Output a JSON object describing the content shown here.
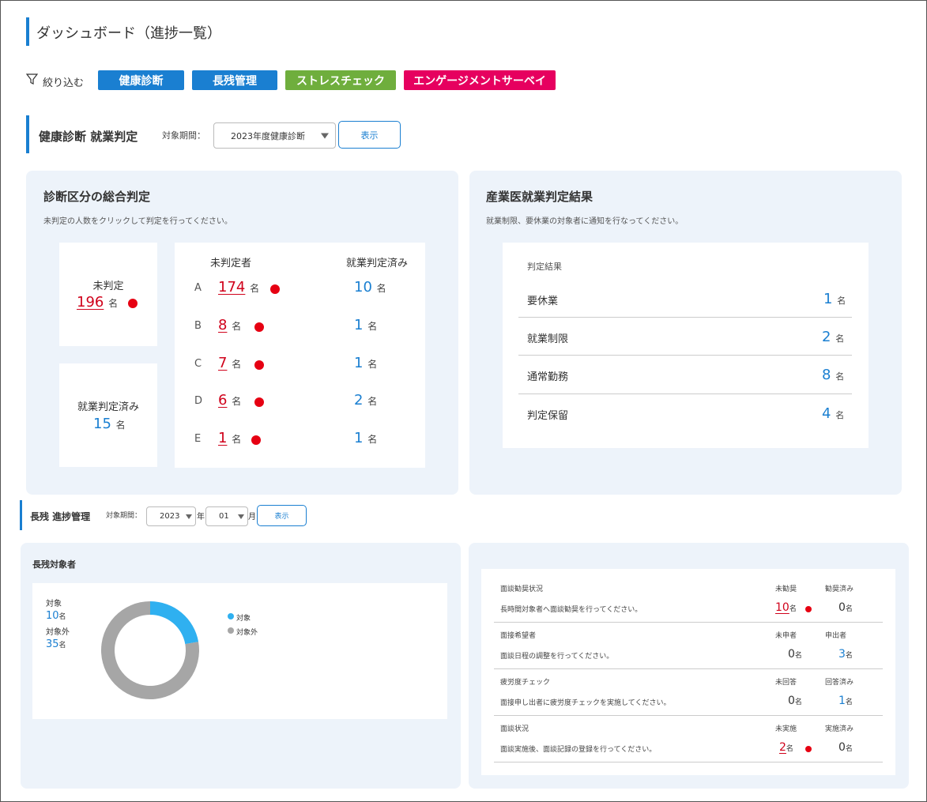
{
  "page_title": "ダッシュボード（進捗一覧）",
  "filter": {
    "label": "絞り込む",
    "chips": [
      {
        "label": "健康診断",
        "color": "#1a7fd1"
      },
      {
        "label": "長残管理",
        "color": "#1a7fd1"
      },
      {
        "label": "ストレスチェック",
        "color": "#6fae3d"
      },
      {
        "label": "エンゲージメントサーベイ",
        "color": "#e6005f"
      }
    ]
  },
  "health": {
    "title": "健康診断 就業判定",
    "period_label": "対象期間：",
    "period_value": "2023年度健康診断",
    "show_button": "表示",
    "overall": {
      "title": "診断区分の総合判定",
      "subtitle": "未判定の人数をクリックして判定を行ってください。",
      "undetermined_label": "未判定",
      "undetermined_value": "196",
      "decided_label": "就業判定済み",
      "decided_value": "15",
      "unit": "名",
      "col_undetermined": "未判定者",
      "col_decided": "就業判定済み",
      "rows": [
        {
          "grade": "A",
          "undetermined": "174",
          "decided": "10"
        },
        {
          "grade": "B",
          "undetermined": "8",
          "decided": "1"
        },
        {
          "grade": "C",
          "undetermined": "7",
          "decided": "1"
        },
        {
          "grade": "D",
          "undetermined": "6",
          "decided": "2"
        },
        {
          "grade": "E",
          "undetermined": "1",
          "decided": "1"
        }
      ]
    },
    "doctor": {
      "title": "産業医就業判定結果",
      "subtitle": "就業制限、要休業の対象者に通知を行なってください。",
      "header": "判定結果",
      "unit": "名",
      "rows": [
        {
          "label": "要休業",
          "value": "1"
        },
        {
          "label": "就業制限",
          "value": "2"
        },
        {
          "label": "通常勤務",
          "value": "8"
        },
        {
          "label": "判定保留",
          "value": "4"
        }
      ]
    }
  },
  "overtime": {
    "title": "長残 進捗管理",
    "period_label": "対象期間：",
    "year_value": "2023",
    "year_suffix": "年",
    "month_value": "01",
    "month_suffix": "月",
    "show_button": "表示",
    "targets": {
      "title": "長残対象者",
      "target_label": "対象",
      "target_value": "10",
      "nontarget_label": "対象外",
      "nontarget_value": "35",
      "unit": "名",
      "legend_target": "対象",
      "legend_nontarget": "対象外",
      "color_target": "#2fb0f0",
      "color_nontarget": "#a6a6a6"
    },
    "status": {
      "unit": "名",
      "rows": [
        {
          "title": "面談勧奨状況",
          "desc": "長時間対象者へ面談勧奨を行ってください。",
          "col1": "未勧奨",
          "col2": "勧奨済み",
          "v1": "10",
          "v2": "0",
          "v1_alert": true,
          "v2_blue": false
        },
        {
          "title": "面接希望者",
          "desc": "面談日程の調整を行ってください。",
          "col1": "未申者",
          "col2": "申出者",
          "v1": "0",
          "v2": "3",
          "v1_alert": false,
          "v2_blue": true
        },
        {
          "title": "疲労度チェック",
          "desc": "面接申し出者に疲労度チェックを実施してください。",
          "col1": "未回答",
          "col2": "回答済み",
          "v1": "0",
          "v2": "1",
          "v1_alert": false,
          "v2_blue": true
        },
        {
          "title": "面談状況",
          "desc": "面談実施後、面談記録の登録を行ってください。",
          "col1": "未実施",
          "col2": "実施済み",
          "v1": "2",
          "v2": "0",
          "v1_alert": true,
          "v2_blue": false
        }
      ]
    }
  }
}
